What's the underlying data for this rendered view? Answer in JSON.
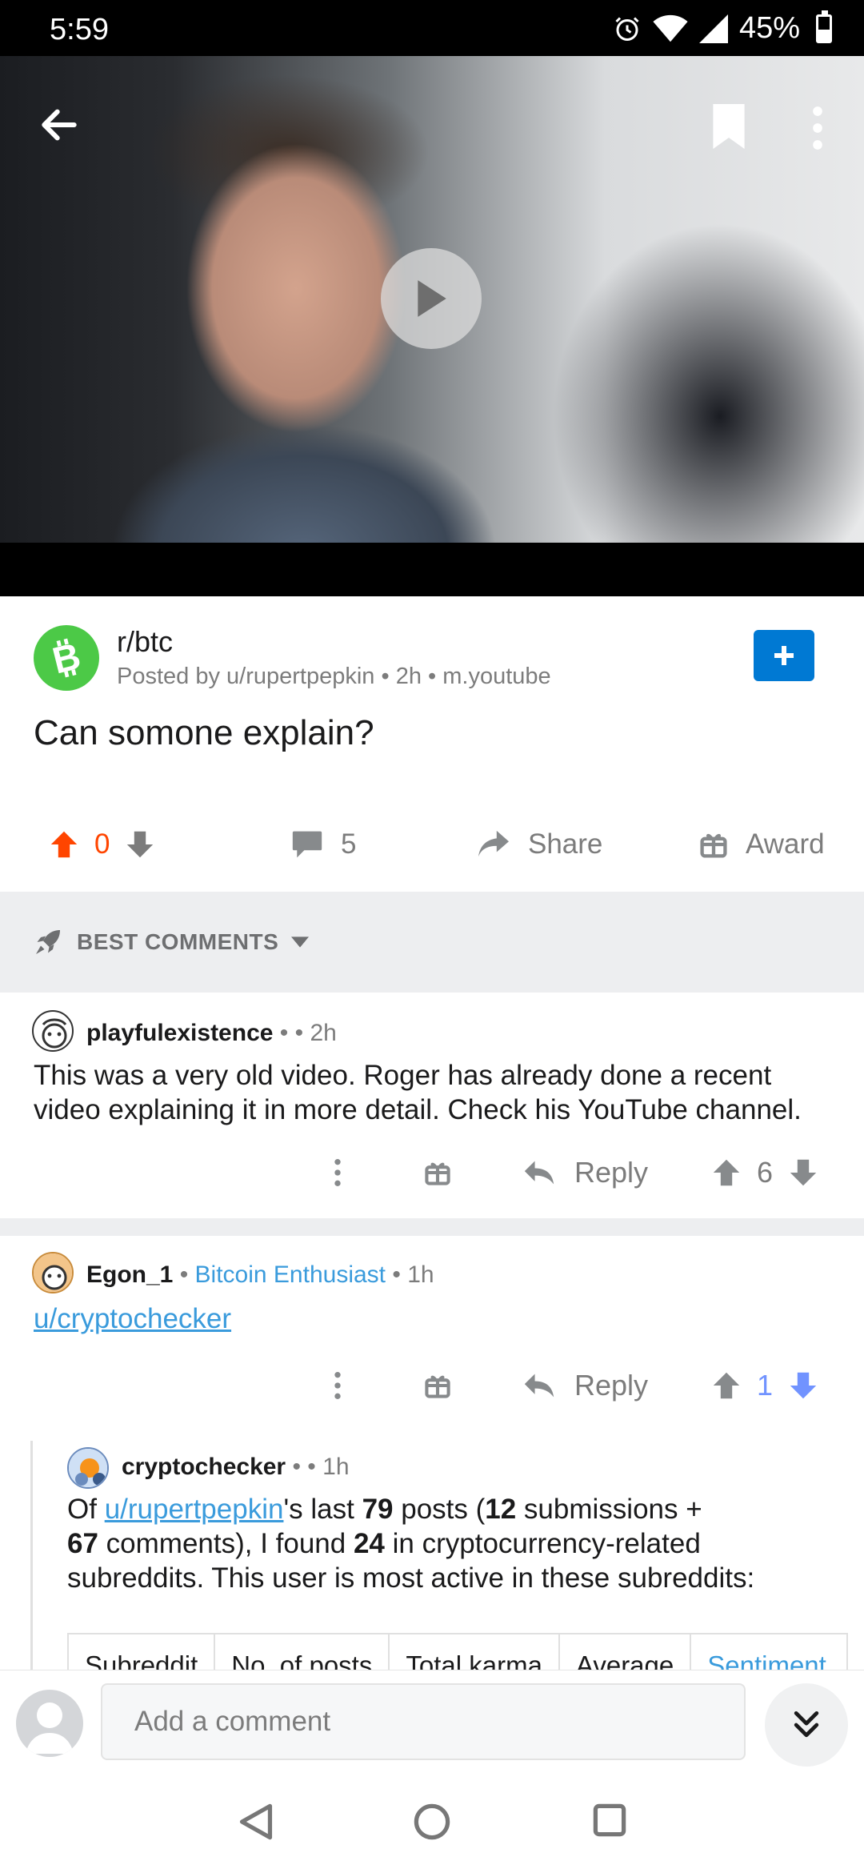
{
  "status_bar": {
    "time": "5:59",
    "battery": "45%",
    "icons": [
      "alarm-icon",
      "wifi-icon",
      "cell-signal-icon",
      "battery-icon"
    ]
  },
  "video": {
    "icons": [
      "back-arrow-icon",
      "bookmark-icon",
      "more-vertical-icon",
      "play-icon"
    ]
  },
  "post": {
    "subreddit": "r/btc",
    "posted_by_prefix": "Posted by ",
    "author": "u/rupertpepkin",
    "age": " • 2h • ",
    "domain": "m.youtube",
    "title": "Can somone explain?",
    "score": "0",
    "comments": "5",
    "share_label": "Share",
    "award_label": "Award",
    "colors": {
      "upvote": "#ff4500",
      "join": "#0079d3",
      "subreddit_icon": "#4cc947"
    }
  },
  "sort": {
    "label": "BEST COMMENTS"
  },
  "comments": [
    {
      "user": "playfulexistence",
      "meta": " • ",
      "age": " • 2h",
      "body": "This was a very old video. Roger has already done a recent video explaining it in more detail. Check his YouTube channel.",
      "reply_label": "Reply",
      "score": "6"
    },
    {
      "user": "Egon_1",
      "sep": " • ",
      "flair": "Bitcoin Enthusiast",
      "age": " • 1h",
      "body_link": "u/cryptochecker",
      "reply_label": "Reply",
      "score": "1"
    },
    {
      "user": "cryptochecker",
      "meta": " • ",
      "age": " • 1h",
      "body": {
        "p1": "Of ",
        "link": "u/rupertpepkin",
        "p2": "'s last ",
        "n1": "79",
        "p3": " posts (",
        "n2": "12",
        "p4": " submissions +",
        "n3": "67",
        "p5": " comments), I found ",
        "n4": "24",
        "p6": " in cryptocurrency-related subreddits. This user is most active in these subreddits:"
      },
      "table_headers": [
        "Subreddit",
        "No. of posts",
        "Total karma",
        "Average",
        "Sentiment"
      ]
    }
  ],
  "composer": {
    "placeholder": "Add a comment"
  }
}
